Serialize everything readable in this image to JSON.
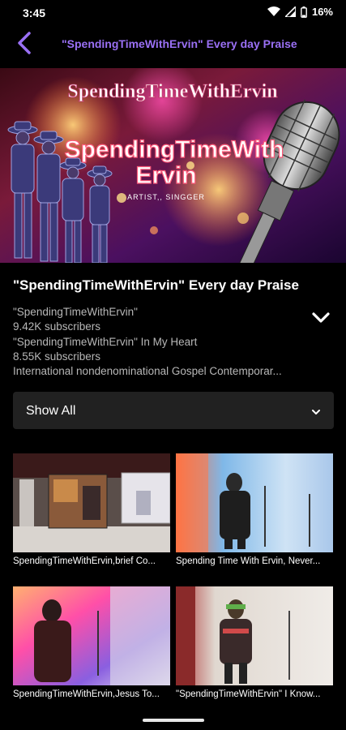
{
  "status": {
    "time": "3:45",
    "battery": "16%"
  },
  "app_bar": {
    "title": "\"SpendingTimeWithErvin\" Every day Praise",
    "accent": "#9a70f5"
  },
  "banner": {
    "headline": "SpendingTimeWithErvin",
    "name_line1": "SpendingTimeWith",
    "name_line2": "Ervin",
    "tagline": "ARTIST,, SINGGER"
  },
  "channel": {
    "title": "\"SpendingTimeWithErvin\" Every day Praise",
    "lines": [
      "\"SpendingTimeWithErvin\"",
      "9.42K subscribers",
      "\"SpendingTimeWithErvin\" In My Heart",
      "8.55K subscribers",
      "International nondenominational Gospel Contemporar..."
    ]
  },
  "filter": {
    "selected": "Show All"
  },
  "videos": [
    {
      "title": "SpendingTimeWithErvin,brief Co..."
    },
    {
      "title": "Spending Time With Ervin, Never..."
    },
    {
      "title": "SpendingTimeWithErvin,Jesus To..."
    },
    {
      "title": "\"SpendingTimeWithErvin\"  I Know..."
    }
  ],
  "icons": {
    "back": "back-arrow-icon",
    "expand": "chevron-down-icon",
    "dropdown": "chevron-down-icon",
    "wifi": "wifi-icon",
    "signal": "signal-icon",
    "battery": "battery-icon"
  }
}
